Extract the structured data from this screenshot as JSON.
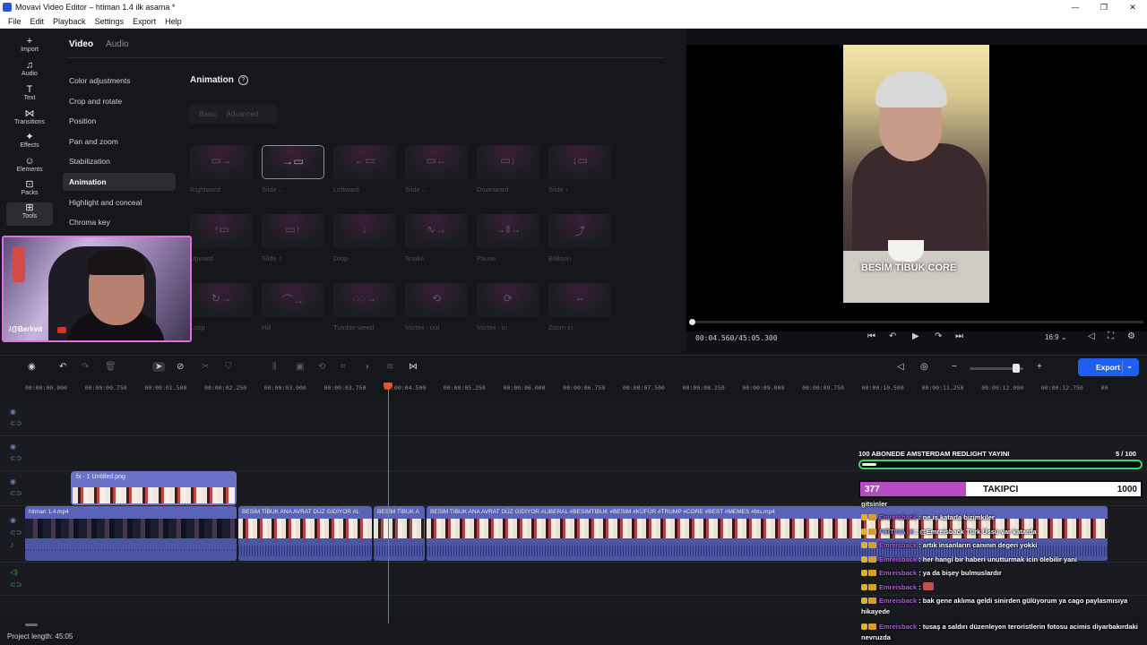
{
  "window": {
    "title": "Movavi Video Editor – htiman 1.4 ilk asama *",
    "minimize": "—",
    "maximize": "❐",
    "close": "✕"
  },
  "menu": [
    "File",
    "Edit",
    "Playback",
    "Settings",
    "Export",
    "Help"
  ],
  "tools": [
    {
      "label": "Import",
      "icon": "plus-icon",
      "glyph": "+"
    },
    {
      "label": "Audio",
      "icon": "music-note-icon",
      "glyph": "♫"
    },
    {
      "label": "Text",
      "icon": "text-icon",
      "glyph": "T"
    },
    {
      "label": "Transitions",
      "icon": "transitions-icon",
      "glyph": "⋈"
    },
    {
      "label": "Effects",
      "icon": "sparkle-icon",
      "glyph": "✦"
    },
    {
      "label": "Elements",
      "icon": "elements-icon",
      "glyph": "☺"
    },
    {
      "label": "Packs",
      "icon": "bag-icon",
      "glyph": "⊡"
    },
    {
      "label": "Tools",
      "icon": "grid-icon",
      "glyph": "⊞"
    }
  ],
  "panel": {
    "tab_video": "Video",
    "tab_audio": "Audio",
    "categories": [
      "Color adjustments",
      "Crop and rotate",
      "Position",
      "Pan and zoom",
      "Stabilization",
      "Animation",
      "Highlight and conceal",
      "Chroma key"
    ],
    "active_category": "Animation",
    "section_title": "Animation",
    "help": "?",
    "segment_basic": "Basic",
    "segment_advanced": "Advanced",
    "presets": [
      {
        "label": "Rightward",
        "glyph": "▭→"
      },
      {
        "label": "Slide ...",
        "glyph": "→▭"
      },
      {
        "label": "Leftward",
        "glyph": "←▭"
      },
      {
        "label": "Slide ...",
        "glyph": "▭←"
      },
      {
        "label": "Downward",
        "glyph": "▭↓"
      },
      {
        "label": "Slide ↓",
        "glyph": "↓▭"
      },
      {
        "label": "Upward",
        "glyph": "↑▭"
      },
      {
        "label": "Slide ↑",
        "glyph": "▭↑"
      },
      {
        "label": "Drop",
        "glyph": "↓"
      },
      {
        "label": "Snake",
        "glyph": "∿→"
      },
      {
        "label": "Pause",
        "glyph": "→‖→"
      },
      {
        "label": "Balloon",
        "glyph": "⤴"
      },
      {
        "label": "Loop",
        "glyph": "↻→"
      },
      {
        "label": "Hill",
        "glyph": "⌒→"
      },
      {
        "label": "Tumble-weed",
        "glyph": "◌◌→"
      },
      {
        "label": "Vortex - out",
        "glyph": "⟲"
      },
      {
        "label": "Vortex - in",
        "glyph": "⟳"
      },
      {
        "label": "Zoom in",
        "glyph": "⇔"
      }
    ],
    "selected_preset": 1
  },
  "webcam": {
    "handle": "/@Berkvd"
  },
  "player": {
    "caption": "BESİM TİBUK CORE",
    "timecode": "00:04.560/45:05.300",
    "ratio": "16:9",
    "progress": 0.0017
  },
  "timeline": {
    "ruler": [
      "00:00:00.000",
      "00:00:00.750",
      "00:00:01.500",
      "00:00:02.250",
      "00:00:03.000",
      "00:00:03.750",
      "00:00:04.500",
      "00:00:05.250",
      "00:00:06.000",
      "00:00:06.750",
      "00:00:07.500",
      "00:00:08.250",
      "00:00:09.000",
      "00:00:09.750",
      "00:00:10.500",
      "00:00:11.250",
      "00:00:12.000",
      "00:00:12.750",
      "00"
    ],
    "overlay_clip": "fx · 1  Untitled.png",
    "clips": [
      "hitman 1.4.mp4",
      "BESİM TİBUK ANA AVRAT DÜZ GİDİYOR #L",
      "BESİM TİBUK A",
      "BESİM TİBUK ANA AVRAT DÜZ GİDİYOR #LIBERAL #BESIMTIBUK #BESIM #KÜFÜR #TRUMP #CORE #BEST #MEMES #bts.mp4"
    ],
    "project_length": "Project length: 45:05"
  },
  "export_label": "Export",
  "stream_overlay": {
    "goal_title": "100 ABONEDE AMSTERDAM REDLIGHT YAYINI",
    "goal_count": "5  / 100",
    "goal_progress": 0.05,
    "sub_current": "377",
    "sub_label": "TAKIPCI",
    "sub_goal": "1000",
    "sub_progress": 0.377,
    "chat": [
      {
        "user": "",
        "text": "gitsinler"
      },
      {
        "user": "Emreisback",
        "text": " : ne iş katarla bizimkiler"
      },
      {
        "user": "FIRTINA_X",
        "text": " : @Emreisback Türk Üssü var katarda"
      },
      {
        "user": "Emreisback",
        "text": " : artık insanların canının degeri yokki"
      },
      {
        "user": "Emreisback",
        "text": " : her hangi bir haberi unutturmak icin ölebilir yani"
      },
      {
        "user": "Emreisback",
        "text": " : ya da bişey bulmuslardır"
      },
      {
        "user": "Emreisback",
        "text": " : "
      },
      {
        "user": "Emreisback",
        "text": " : bak gene aklıma geldi sinirden gülüyorum ya cago paylasmısıya hikayede"
      },
      {
        "user": "Emreisback",
        "text": " : tusaş a saldırı düzenleyen teroristlerin fotosu acimis diyarbakırdaki nevruzda"
      }
    ]
  }
}
